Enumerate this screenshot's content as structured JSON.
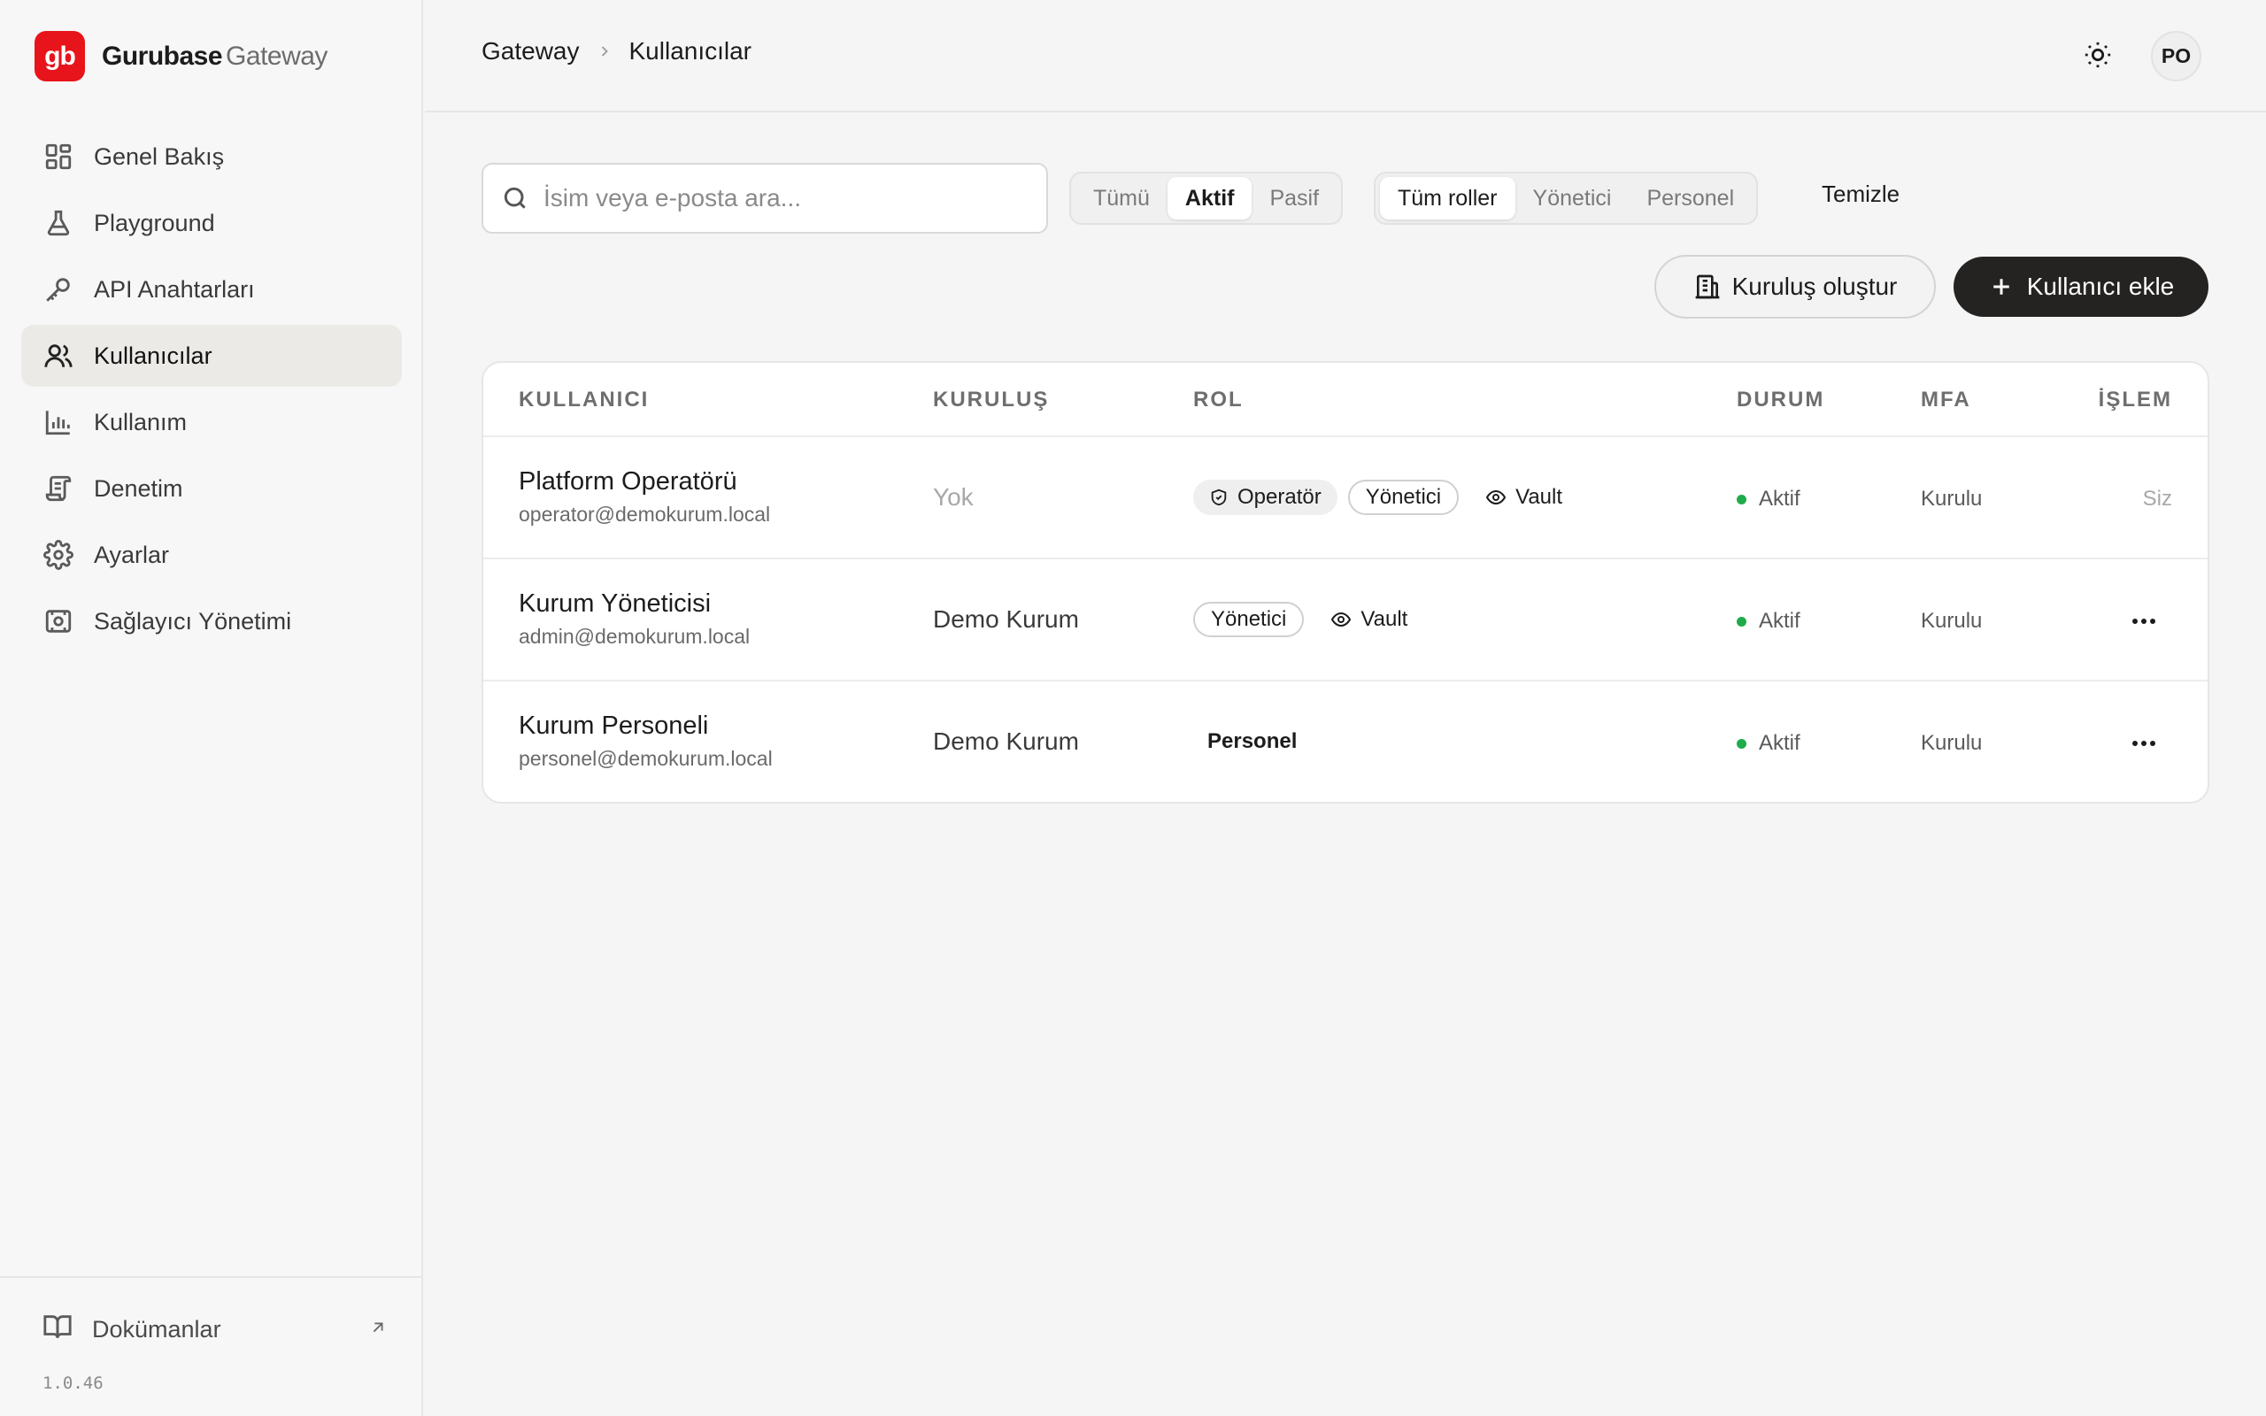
{
  "brand": {
    "logo": "gb",
    "name": "Gurubase",
    "suffix": "Gateway"
  },
  "sidebar": {
    "items": [
      {
        "label": "Genel Bakış",
        "icon": "dashboard-grid-icon"
      },
      {
        "label": "Playground",
        "icon": "flask-icon"
      },
      {
        "label": "API Anahtarları",
        "icon": "key-icon"
      },
      {
        "label": "Kullanıcılar",
        "icon": "users-icon",
        "active": true
      },
      {
        "label": "Kullanım",
        "icon": "bar-chart-icon"
      },
      {
        "label": "Denetim",
        "icon": "scroll-icon"
      },
      {
        "label": "Ayarlar",
        "icon": "gear-icon"
      },
      {
        "label": "Sağlayıcı Yönetimi",
        "icon": "provider-icon"
      }
    ],
    "docs_label": "Dokümanlar",
    "version": "1.0.46"
  },
  "header": {
    "breadcrumb_root": "Gateway",
    "breadcrumb_current": "Kullanıcılar",
    "avatar_initials": "PO"
  },
  "toolbar": {
    "search_placeholder": "İsim veya e-posta ara...",
    "search_value": "",
    "status_filter": {
      "options": [
        "Tümü",
        "Aktif",
        "Pasif"
      ],
      "selected": "Aktif"
    },
    "role_filter": {
      "options": [
        "Tüm roller",
        "Yönetici",
        "Personel"
      ],
      "selected": "Tüm roller"
    },
    "clear_label": "Temizle",
    "create_org_label": "Kuruluş oluştur",
    "add_user_label": "Kullanıcı ekle"
  },
  "table": {
    "columns": [
      "KULLANICI",
      "KURULUŞ",
      "ROL",
      "DURUM",
      "MFA",
      "İŞLEM"
    ],
    "rows": [
      {
        "name": "Platform Operatörü",
        "email": "operator@demokurum.local",
        "org": "Yok",
        "roles": [
          "Operatör",
          "Yönetici"
        ],
        "vault": "Vault",
        "status": "Aktif",
        "mfa": "Kurulu",
        "action": "Siz"
      },
      {
        "name": "Kurum Yöneticisi",
        "email": "admin@demokurum.local",
        "org": "Demo Kurum",
        "roles": [
          "Yönetici"
        ],
        "vault": "Vault",
        "status": "Aktif",
        "mfa": "Kurulu",
        "action": ""
      },
      {
        "name": "Kurum Personeli",
        "email": "personel@demokurum.local",
        "org": "Demo Kurum",
        "roles": [
          "Personel"
        ],
        "vault": "",
        "status": "Aktif",
        "mfa": "Kurulu",
        "action": ""
      }
    ]
  },
  "colors": {
    "brand_red": "#e8141b",
    "status_green": "#1fab4a",
    "dark_button": "#252322"
  }
}
